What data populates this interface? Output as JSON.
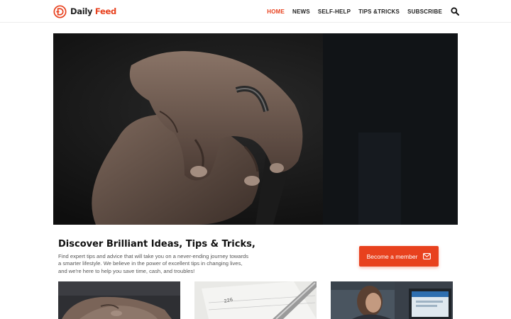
{
  "brand": {
    "name_part1": "Daily",
    "name_part2": "Feed",
    "accent_color": "#e8411e"
  },
  "nav": {
    "items": [
      {
        "label": "HOME",
        "active": true
      },
      {
        "label": "NEWS",
        "active": false
      },
      {
        "label": "SELF-HELP",
        "active": false
      },
      {
        "label": "TIPS &TRICKS",
        "active": false
      },
      {
        "label": "SUBSCRIBE",
        "active": false
      }
    ],
    "search_icon": "search-icon"
  },
  "hero": {
    "image": "elderly-hands-on-cane-photo"
  },
  "intro": {
    "title": "Discover Brilliant Ideas, Tips & Tricks,",
    "text": "Find expert tips and advice that will take you on a never-ending journey towards a smarter lifestyle. We believe in the power of excellent tips in changing lives, and we're here to help you save time, cash, and troubles!",
    "cta_label": "Become a member",
    "cta_icon": "envelope-icon"
  },
  "cards": [
    {
      "image": "elderly-hands-photo"
    },
    {
      "image": "paper-with-pen-photo"
    },
    {
      "image": "woman-at-kiosk-photo"
    }
  ]
}
